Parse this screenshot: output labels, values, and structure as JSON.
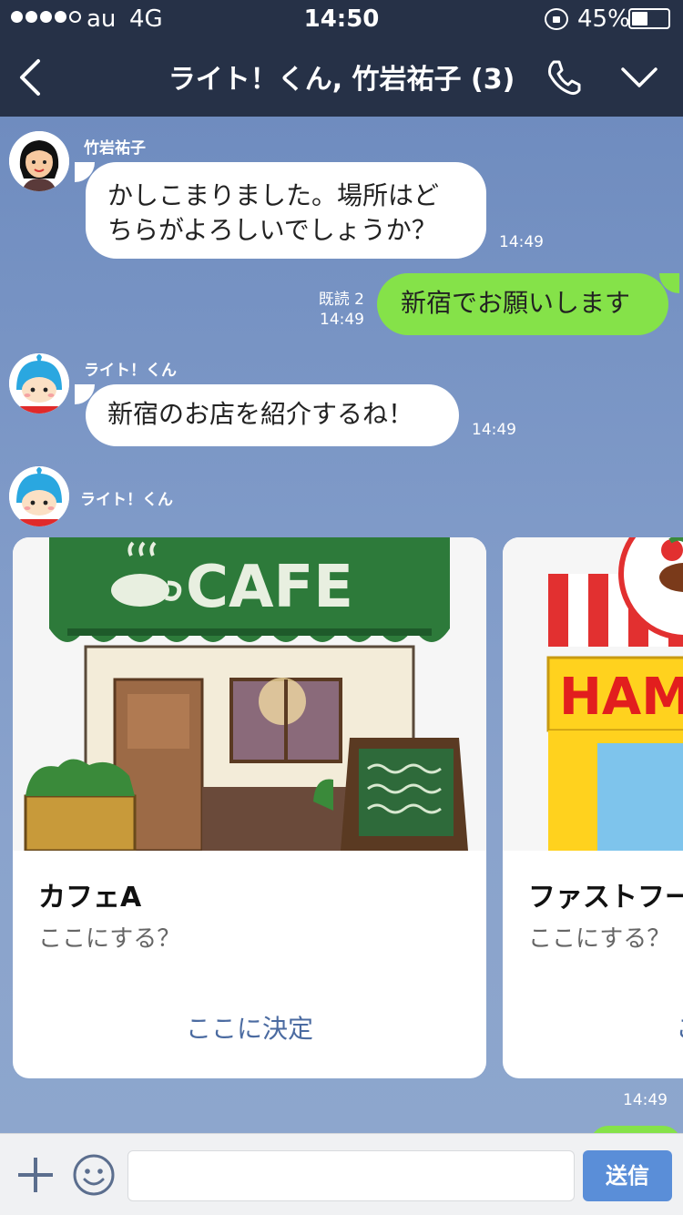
{
  "status_bar": {
    "carrier": "au",
    "network": "4G",
    "time": "14:50",
    "battery_percent": "45%",
    "battery_level": 0.45
  },
  "header": {
    "title": "ライト！くん, 竹岩祐子 (3)"
  },
  "messages": [
    {
      "sender": "竹岩祐子",
      "text_line1": "かしこまりました。場所はど",
      "text_line2": "ちらがよろしいでしょうか？",
      "time": "14:49"
    },
    {
      "read": "既読 2",
      "time": "14:49",
      "text": "新宿でお願いします"
    },
    {
      "sender": "ライト！くん",
      "text": "新宿のお店を紹介するね！",
      "time": "14:49"
    },
    {
      "sender": "ライト！くん"
    }
  ],
  "carousel": {
    "cards": [
      {
        "image_sign": "CAFE",
        "title": "カフェA",
        "subtitle": "ここにする？",
        "button": "ここに決定"
      },
      {
        "image_sign": "HAM",
        "title": "ファストフード",
        "subtitle": "ここにする？",
        "button": "ここに決定"
      }
    ],
    "time": "14:49"
  },
  "input_bar": {
    "placeholder": "",
    "send_label": "送信"
  },
  "colors": {
    "header_bg": "#263147",
    "own_bubble": "#85e249",
    "send_button": "#5a8ed8",
    "card_button_text": "#4b6ba1"
  },
  "icons": [
    "back-chevron-icon",
    "phone-icon",
    "chevron-down-icon",
    "plus-icon",
    "emoji-icon",
    "lock-rotation-icon",
    "battery-icon"
  ]
}
